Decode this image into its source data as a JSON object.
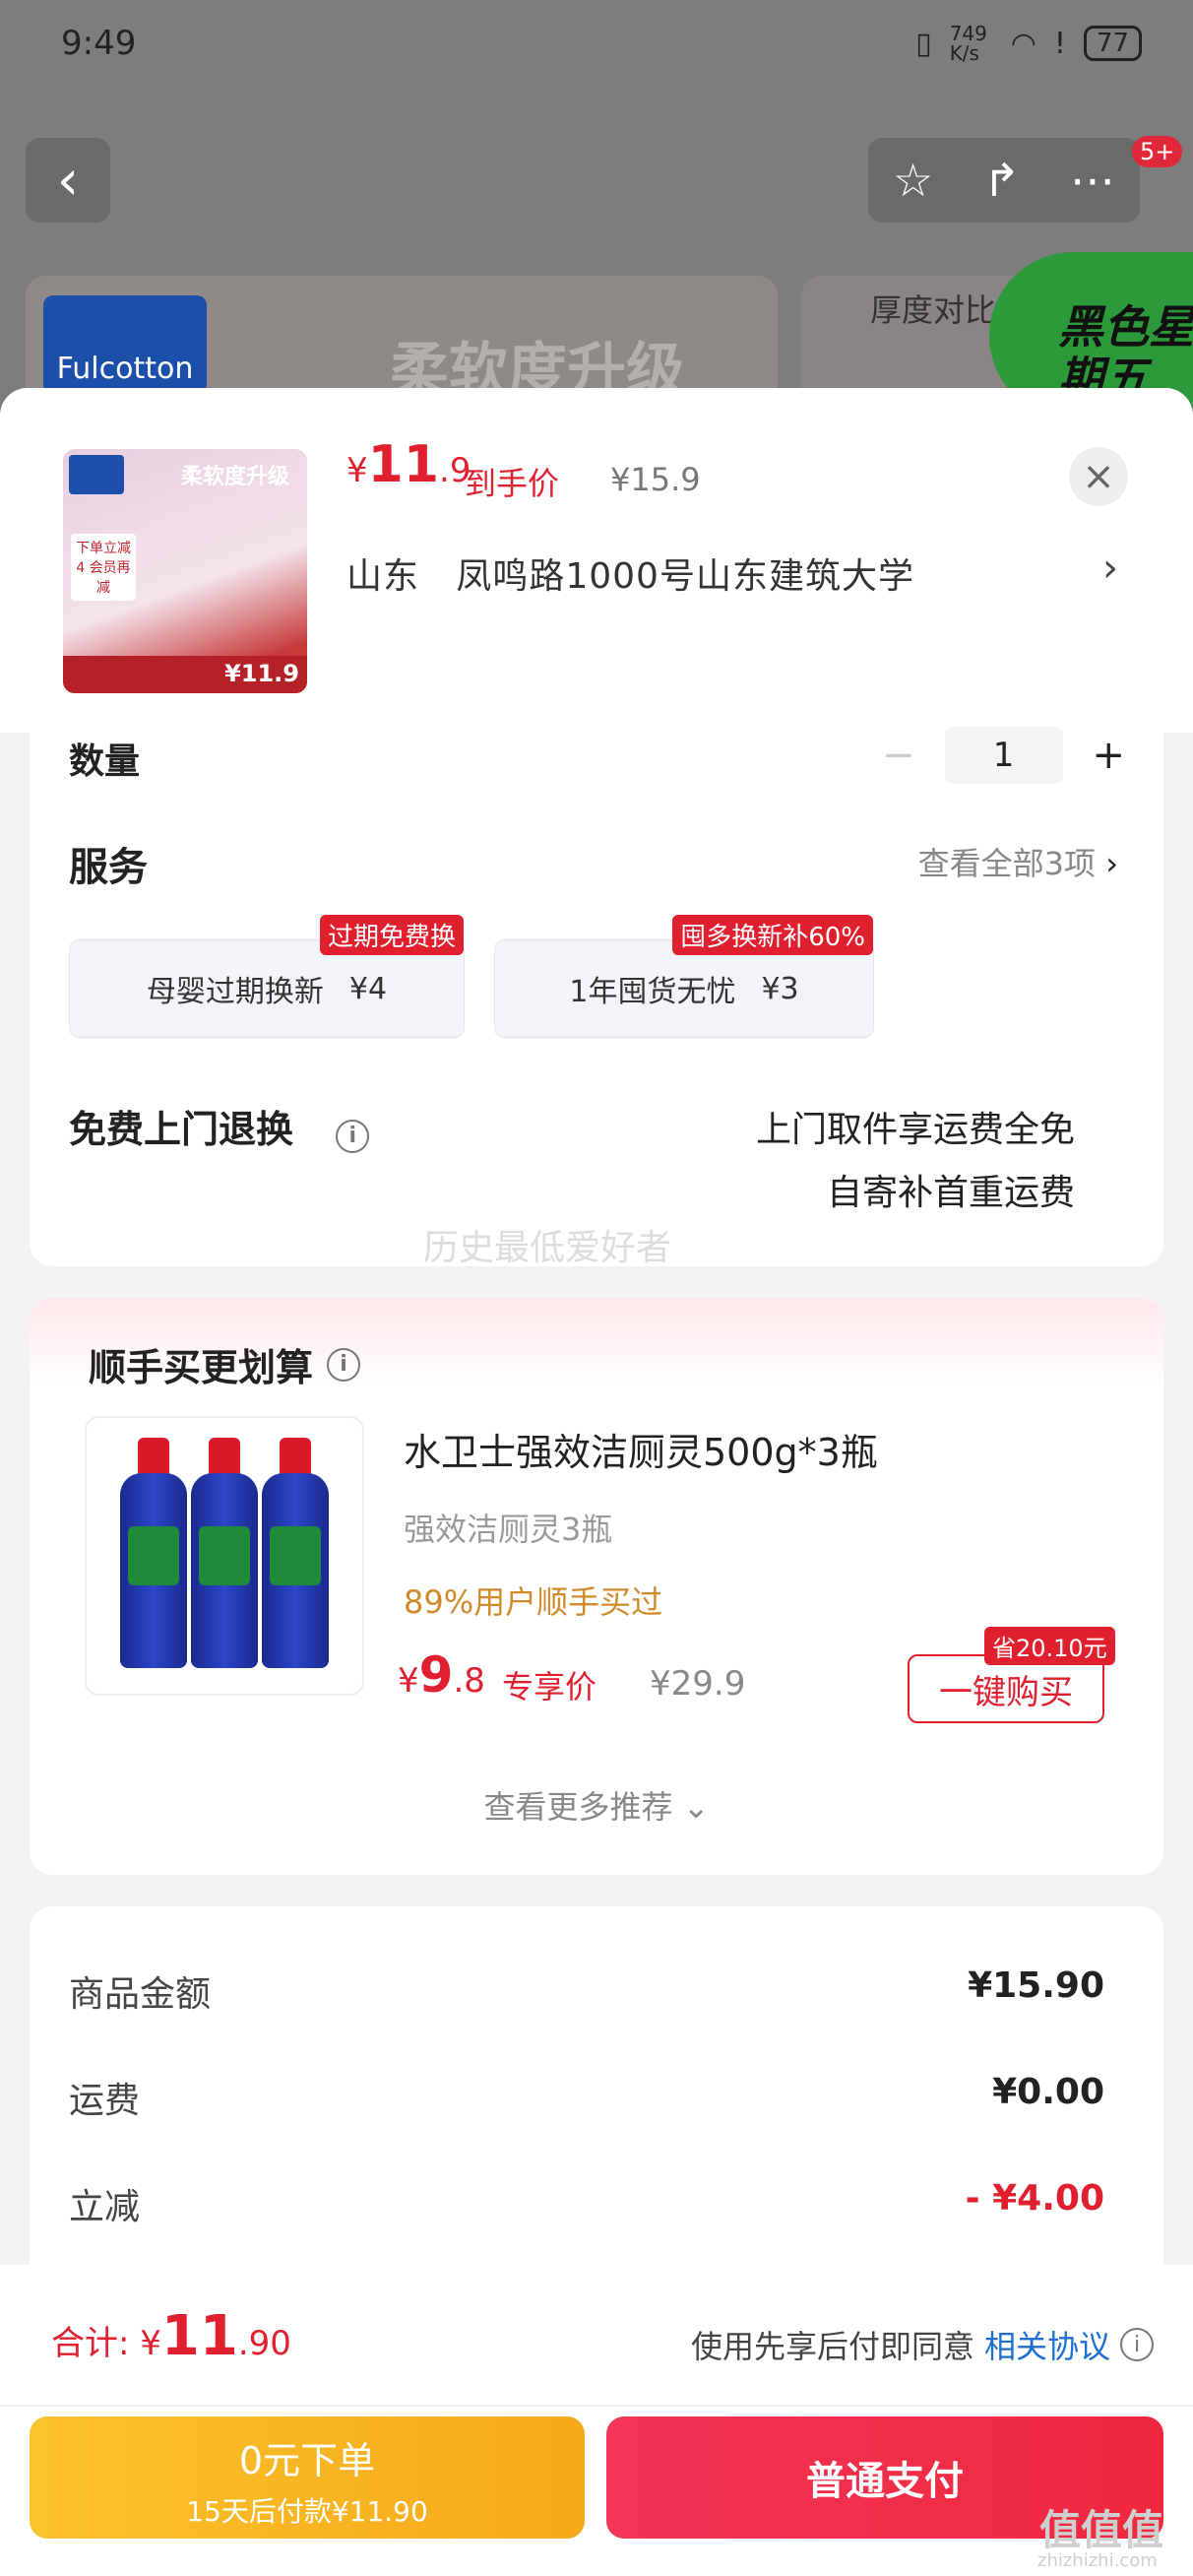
{
  "status_bar": {
    "time": "9:49",
    "net_speed": "749 K/s",
    "battery": "77"
  },
  "background": {
    "badge": "5+",
    "banner_brand": "Fulcotton",
    "banner_text": "柔软度升级",
    "banner_right_text": "厚度对比",
    "green_promo": "黑色星期五"
  },
  "sheet": {
    "thumb": {
      "headline": "柔软度升级",
      "note": "下单立减4 会员再减",
      "price": "¥11.9"
    },
    "price_symbol": "¥",
    "price_int": "11",
    "price_dec": ".9",
    "price_label": "到手价",
    "original_price": "¥15.9",
    "address": "山东   凤鸣路1000号山东建筑大学",
    "quantity_label": "数量",
    "quantity_value": "1",
    "services": {
      "title": "服务",
      "view_all": "查看全部3项",
      "options": [
        {
          "label": "母婴过期换新",
          "price": "¥4",
          "badge": "过期免费换"
        },
        {
          "label": "1年囤货无忧",
          "price": "¥3",
          "badge": "囤多换新补60%"
        }
      ]
    },
    "free_return": {
      "title": "免费上门退换",
      "line1": "上门取件享运费全免",
      "line2": "自寄补首重运费",
      "watermark": "历史最低爱好者"
    },
    "recommend": {
      "title": "顺手买更划算",
      "product_name": "水卫士强效洁厕灵500g*3瓶",
      "subtitle": "强效洁厕灵3瓶",
      "popularity": "89%用户顺手买过",
      "price_symbol": "¥",
      "price_int": "9",
      "price_dec": ".8",
      "price_label": "专享价",
      "original_price": "¥29.9",
      "save_tag": "省20.10元",
      "buy_label": "一键购买",
      "more_label": "查看更多推荐"
    },
    "summary": {
      "rows": [
        {
          "label": "商品金额",
          "value": "¥15.90"
        },
        {
          "label": "运费",
          "value": "¥0.00"
        },
        {
          "label": "立减",
          "value": "- ¥4.00"
        }
      ]
    }
  },
  "bottom_bar": {
    "total_label": "合计:",
    "total_symbol": "¥",
    "total_int": "11",
    "total_dec": ".90",
    "agree_text": "使用先享后付即同意",
    "agree_link": "相关协议",
    "pay_later_title": "0元下单",
    "pay_later_sub": "15天后付款¥11.90",
    "pay_now": "普通支付"
  },
  "watermark_site": {
    "name": "值值值",
    "domain": "zhizhizhi.com"
  },
  "colors": {
    "accent_red": "#e0202f",
    "link_blue": "#1f6fd0",
    "pay_later_yellow": "#fbc22c"
  }
}
